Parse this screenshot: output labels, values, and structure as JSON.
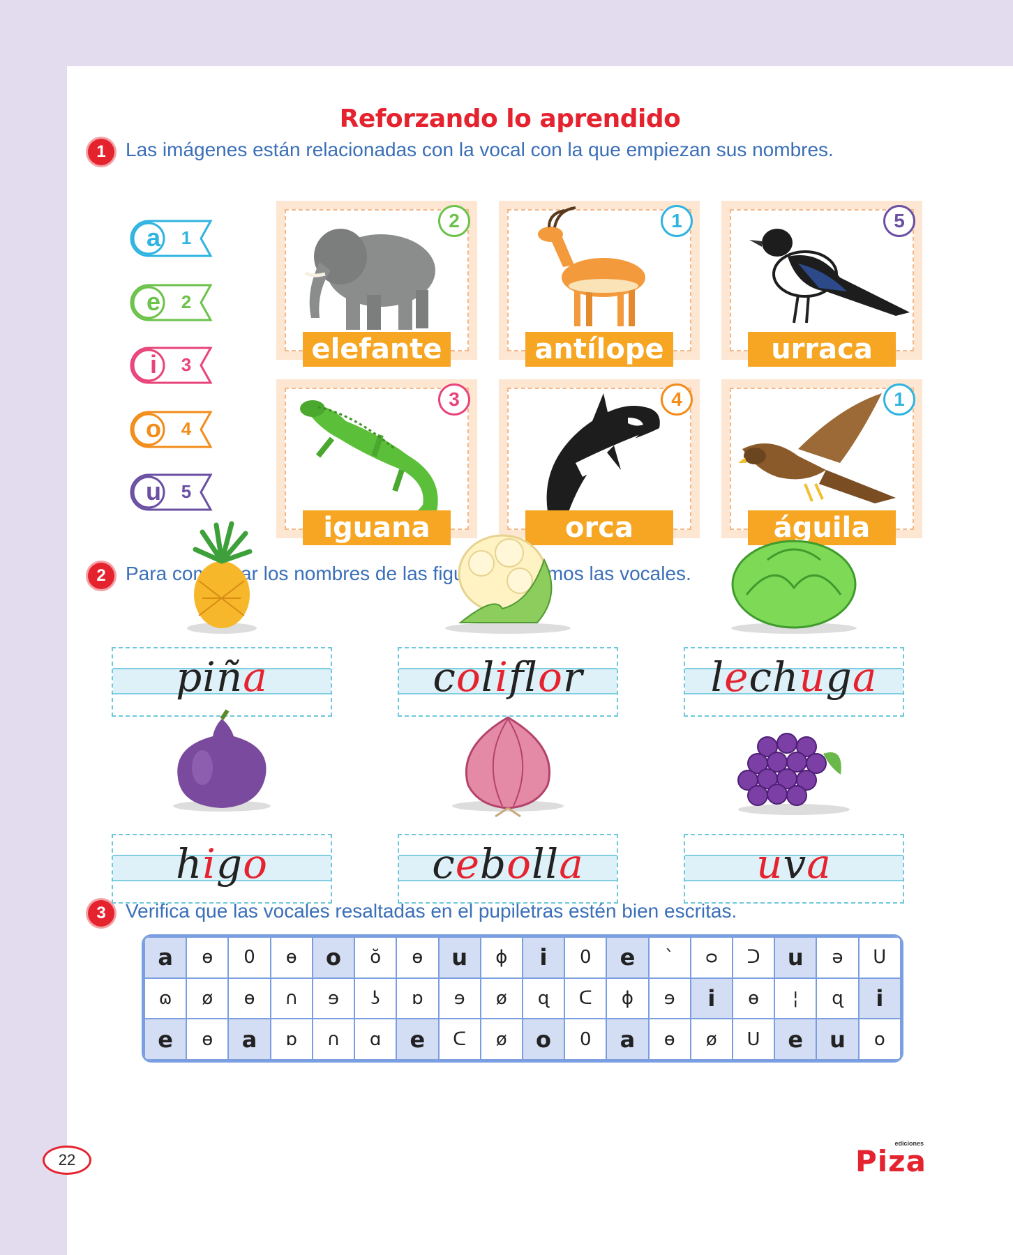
{
  "title": "Reforzando lo aprendido",
  "page_number": "22",
  "logo": {
    "small": "ediciones",
    "main": "Piza"
  },
  "q1": {
    "number": "1",
    "text": "Las imágenes están relacionadas con la vocal con la que empiezan sus nombres."
  },
  "q2": {
    "number": "2",
    "text": "Para completar los nombres de las figuras utilizamos las vocales."
  },
  "q3": {
    "number": "3",
    "text": "Verifica que las vocales resaltadas en el pupiletras estén bien escritas."
  },
  "vowel_tags": [
    {
      "letter": "a",
      "number": "1",
      "color": "#2fb4e0"
    },
    {
      "letter": "e",
      "number": "2",
      "color": "#6cc24a"
    },
    {
      "letter": "i",
      "number": "3",
      "color": "#e8447a"
    },
    {
      "letter": "o",
      "number": "4",
      "color": "#f28c1a"
    },
    {
      "letter": "u",
      "number": "5",
      "color": "#6a4fa3"
    }
  ],
  "animals": [
    {
      "name": "elefante",
      "number": "2",
      "color": "#6cc24a",
      "icon": "elephant-icon"
    },
    {
      "name": "antílope",
      "number": "1",
      "color": "#2fb4e0",
      "icon": "antelope-icon"
    },
    {
      "name": "urraca",
      "number": "5",
      "color": "#6a4fa3",
      "icon": "magpie-icon"
    },
    {
      "name": "iguana",
      "number": "3",
      "color": "#e8447a",
      "icon": "iguana-icon"
    },
    {
      "name": "orca",
      "number": "4",
      "color": "#f28c1a",
      "icon": "orca-icon"
    },
    {
      "name": "águila",
      "number": "1",
      "color": "#2fb4e0",
      "icon": "eagle-icon"
    }
  ],
  "fruits": [
    {
      "icon": "pineapple-icon",
      "parts": [
        [
          "pi",
          "b"
        ],
        [
          "ñ",
          "b"
        ],
        [
          "a",
          "r"
        ]
      ]
    },
    {
      "icon": "cauliflower-icon",
      "parts": [
        [
          "c",
          "b"
        ],
        [
          "o",
          "r"
        ],
        [
          "l",
          "b"
        ],
        [
          "i",
          "r"
        ],
        [
          "fl",
          "b"
        ],
        [
          "o",
          "r"
        ],
        [
          "r",
          "b"
        ]
      ]
    },
    {
      "icon": "lettuce-icon",
      "parts": [
        [
          "l",
          "b"
        ],
        [
          "e",
          "r"
        ],
        [
          "ch",
          "b"
        ],
        [
          "u",
          "r"
        ],
        [
          "g",
          "b"
        ],
        [
          "a",
          "r"
        ]
      ]
    },
    {
      "icon": "fig-icon",
      "parts": [
        [
          "h",
          "b"
        ],
        [
          "i",
          "r"
        ],
        [
          "g",
          "b"
        ],
        [
          "o",
          "r"
        ]
      ]
    },
    {
      "icon": "onion-icon",
      "parts": [
        [
          "c",
          "b"
        ],
        [
          "e",
          "r"
        ],
        [
          "b",
          "b"
        ],
        [
          "o",
          "r"
        ],
        [
          "ll",
          "b"
        ],
        [
          "a",
          "r"
        ]
      ]
    },
    {
      "icon": "grapes-icon",
      "parts": [
        [
          "u",
          "r"
        ],
        [
          "v",
          "b"
        ],
        [
          "a",
          "r"
        ]
      ]
    }
  ],
  "grid": [
    [
      "a",
      "ɵ",
      "0",
      "ɵ",
      "o",
      "ŏ",
      "ɵ",
      "u",
      "ɸ",
      "i",
      "0",
      "e",
      "ˋ",
      "ᴑ",
      "ᑐ",
      "u",
      "ə",
      "ᑌ"
    ],
    [
      "ɷ",
      "ø",
      "ɵ",
      "∩",
      "ɘ",
      "ʖ",
      "ɒ",
      "ɘ",
      "ø",
      "ɋ",
      "ᑕ",
      "ɸ",
      "ɘ",
      "i",
      "ɵ",
      "¦",
      "ɋ",
      "i"
    ],
    [
      "e",
      "ɵ",
      "a",
      "ɒ",
      "∩",
      "ɑ",
      "e",
      "ᑕ",
      "ø",
      "o",
      "0",
      "a",
      "ɵ",
      "ø",
      "U",
      "e",
      "u",
      "o"
    ]
  ],
  "grid_highlight": [
    [
      0,
      4,
      7,
      9,
      11,
      15
    ],
    [
      13,
      17
    ],
    [
      0,
      2,
      6,
      9,
      11,
      15,
      16
    ]
  ]
}
